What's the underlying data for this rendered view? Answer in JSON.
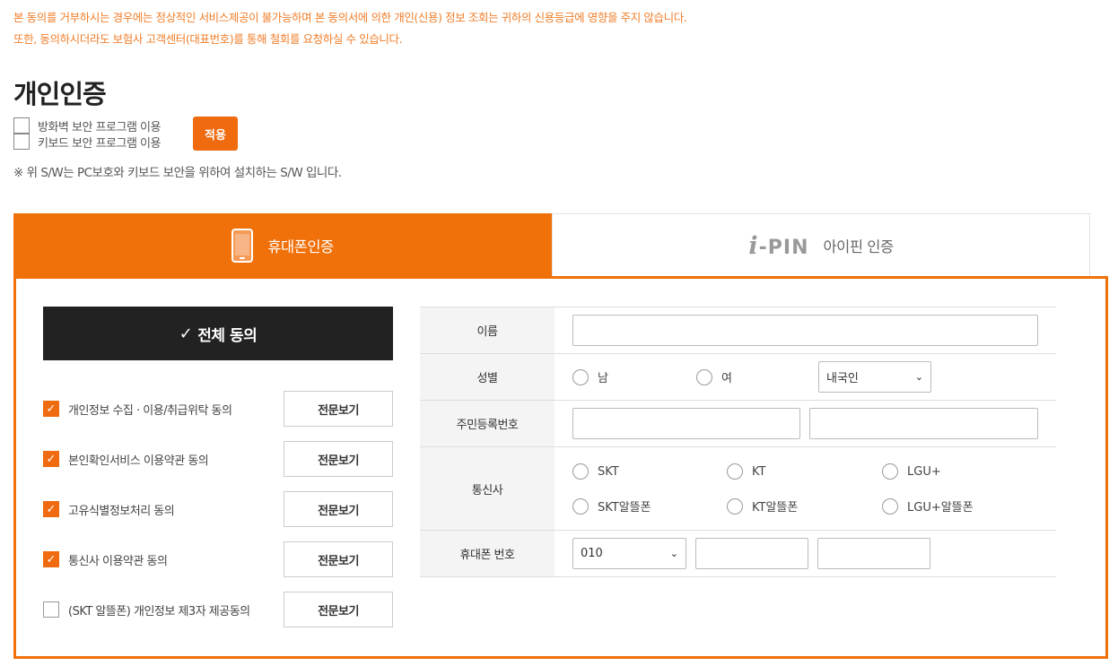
{
  "notice": {
    "line1": "본 동의를 거부하시는 경우에는 정상적인 서비스제공이 불가능하며 본 동의서에 의한 개인(신용) 정보 조회는 귀하의 신용등급에 영향을 주지 않습니다.",
    "line2": "또한, 동의하시더라도 보험사 고객센터(대표번호)를 통해 철회를 요청하실 수 있습니다."
  },
  "section_title": "개인인증",
  "security": {
    "firewall_label": "방화벽 보안 프로그램 이용",
    "keyboard_label": "키보드 보안 프로그램 이용",
    "apply_label": "적용",
    "note": "※ 위 S/W는 PC보호와 키보드 보안을 위하여 설치하는 S/W 입니다."
  },
  "tabs": {
    "phone_label": "휴대폰인증",
    "ipin_logo_prefix": "i",
    "ipin_logo_suffix": "-PIN",
    "ipin_label": "아이핀 인증"
  },
  "agreement": {
    "all_check_glyph": "✓",
    "all_label": "전체 동의",
    "view_label": "전문보기",
    "items": [
      {
        "label": "개인정보 수집 · 이용/취급위탁 동의",
        "checked": true
      },
      {
        "label": "본인확인서비스 이용약관 동의",
        "checked": true
      },
      {
        "label": "고유식별정보처리 동의",
        "checked": true
      },
      {
        "label": "통신사 이용약관 동의",
        "checked": true
      },
      {
        "label": "(SKT 알뜰폰) 개인정보 제3자 제공동의",
        "checked": false
      }
    ]
  },
  "form": {
    "name_label": "이름",
    "gender_label": "성별",
    "gender_male": "남",
    "gender_female": "여",
    "nationality_value": "내국인",
    "rrn_label": "주민등록번호",
    "carrier_label": "통신사",
    "carriers": [
      "SKT",
      "KT",
      "LGU+",
      "SKT알뜰폰",
      "KT알뜰폰",
      "LGU+알뜰폰"
    ],
    "phone_label": "휴대폰 번호",
    "phone_prefix_value": "010"
  },
  "colors": {
    "accent": "#f0700a",
    "dark": "#222222"
  }
}
